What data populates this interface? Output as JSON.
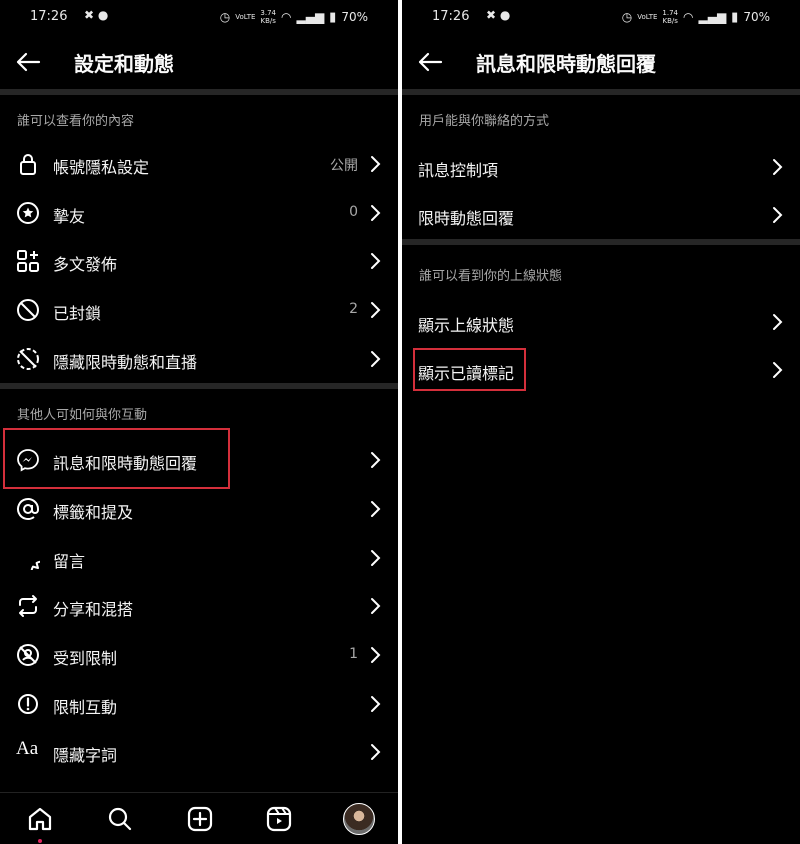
{
  "status_bar": {
    "time": "17:26",
    "speed_left": "3.74\nKB/s",
    "speed_right": "1.74\nKB/s",
    "battery": "70%"
  },
  "left": {
    "title": "設定和動態",
    "section1": "誰可以查看你的內容",
    "items1": [
      {
        "label": "帳號隱私設定",
        "value": "公開",
        "icon": "lock-icon"
      },
      {
        "label": "摯友",
        "value": "0",
        "icon": "star-circle-icon"
      },
      {
        "label": "多文發佈",
        "value": "",
        "icon": "grid-plus-icon"
      },
      {
        "label": "已封鎖",
        "value": "2",
        "icon": "block-icon"
      },
      {
        "label": "隱藏限時動態和直播",
        "value": "",
        "icon": "story-hide-icon"
      }
    ],
    "section2": "其他人可如何與你互動",
    "items2": [
      {
        "label": "訊息和限時動態回覆",
        "value": "",
        "icon": "messenger-icon"
      },
      {
        "label": "標籤和提及",
        "value": "",
        "icon": "at-icon"
      },
      {
        "label": "留言",
        "value": "",
        "icon": "comment-icon"
      },
      {
        "label": "分享和混搭",
        "value": "",
        "icon": "share-remix-icon"
      },
      {
        "label": "受到限制",
        "value": "1",
        "icon": "restricted-icon"
      },
      {
        "label": "限制互動",
        "value": "",
        "icon": "limit-interactions-icon"
      },
      {
        "label": "隱藏字詞",
        "value": "",
        "icon": "hidden-words-icon"
      }
    ]
  },
  "right": {
    "title": "訊息和限時動態回覆",
    "section1": "用戶能與你聯絡的方式",
    "items1": [
      {
        "label": "訊息控制項"
      },
      {
        "label": "限時動態回覆"
      }
    ],
    "section2": "誰可以看到你的上線狀態",
    "items2": [
      {
        "label": "顯示上線狀態"
      },
      {
        "label": "顯示已讀標記"
      }
    ]
  },
  "bottom_nav": [
    "home-icon",
    "search-icon",
    "create-icon",
    "reels-icon",
    "profile-avatar"
  ],
  "colors": {
    "background": "#000000",
    "highlight": "#d42f3b",
    "separator": "#262626",
    "secondary_text": "#a8a8a8"
  }
}
